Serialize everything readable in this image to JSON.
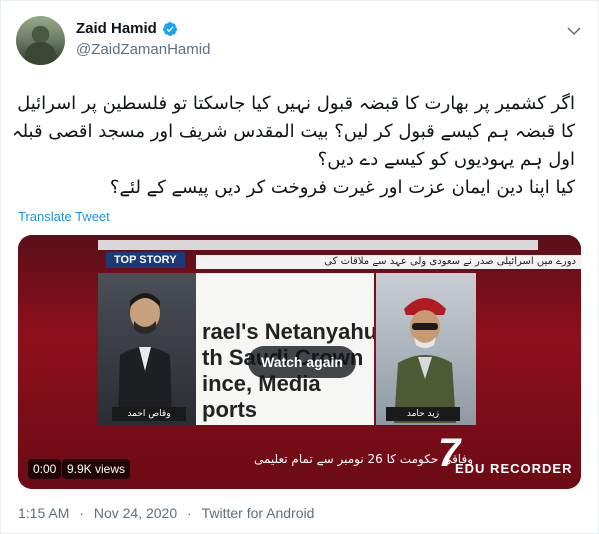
{
  "author": {
    "display_name": "Zaid Hamid",
    "handle": "@ZaidZamanHamid",
    "verified": true
  },
  "tweet": {
    "lines": [
      "اگر کشمیر پر بھارت کا قبضہ قبول نہیں کیا جاسکتا تو فلسطین پر اسرائیل",
      "کا قبضہ ہم کیسے قبول کر لیں؟ بیت المقدس شریف اور مسجد اقصی قبلہ",
      "اول ہم یہودیوں کو کیسے دے دیں؟",
      "کیا اپنا دین ایمان عزت اور غیرت فروخت کر دیں پیسے کے لئے؟"
    ],
    "translate_label": "Translate Tweet"
  },
  "media": {
    "top_story_label": "TOP STORY",
    "urdu_banner": "دورے میں اسرائیلی صدر نے سعودی ولی عہد سے ملاقات کی",
    "center_text_lines": [
      "rael's Netanyahu M",
      "th Saudi Crown",
      "ince, Media",
      "ports"
    ],
    "left_name_tag": "وقاص احمد",
    "right_name_tag": "زید حامد",
    "bottom_strip": "وفاقی حکومت کا 26 نومبر سے تمام تعلیمی",
    "channel_number": "7",
    "channel_name": "EDU RECORDER",
    "watch_again_label": "Watch again",
    "time": "0:00",
    "views": "9.9K views"
  },
  "meta": {
    "time": "1:15 AM",
    "date": "Nov 24, 2020",
    "separator": "·",
    "source": "Twitter for Android"
  },
  "colors": {
    "link": "#1b95e0",
    "verified": "#1da1f2",
    "secondary_text": "#5b7083"
  }
}
